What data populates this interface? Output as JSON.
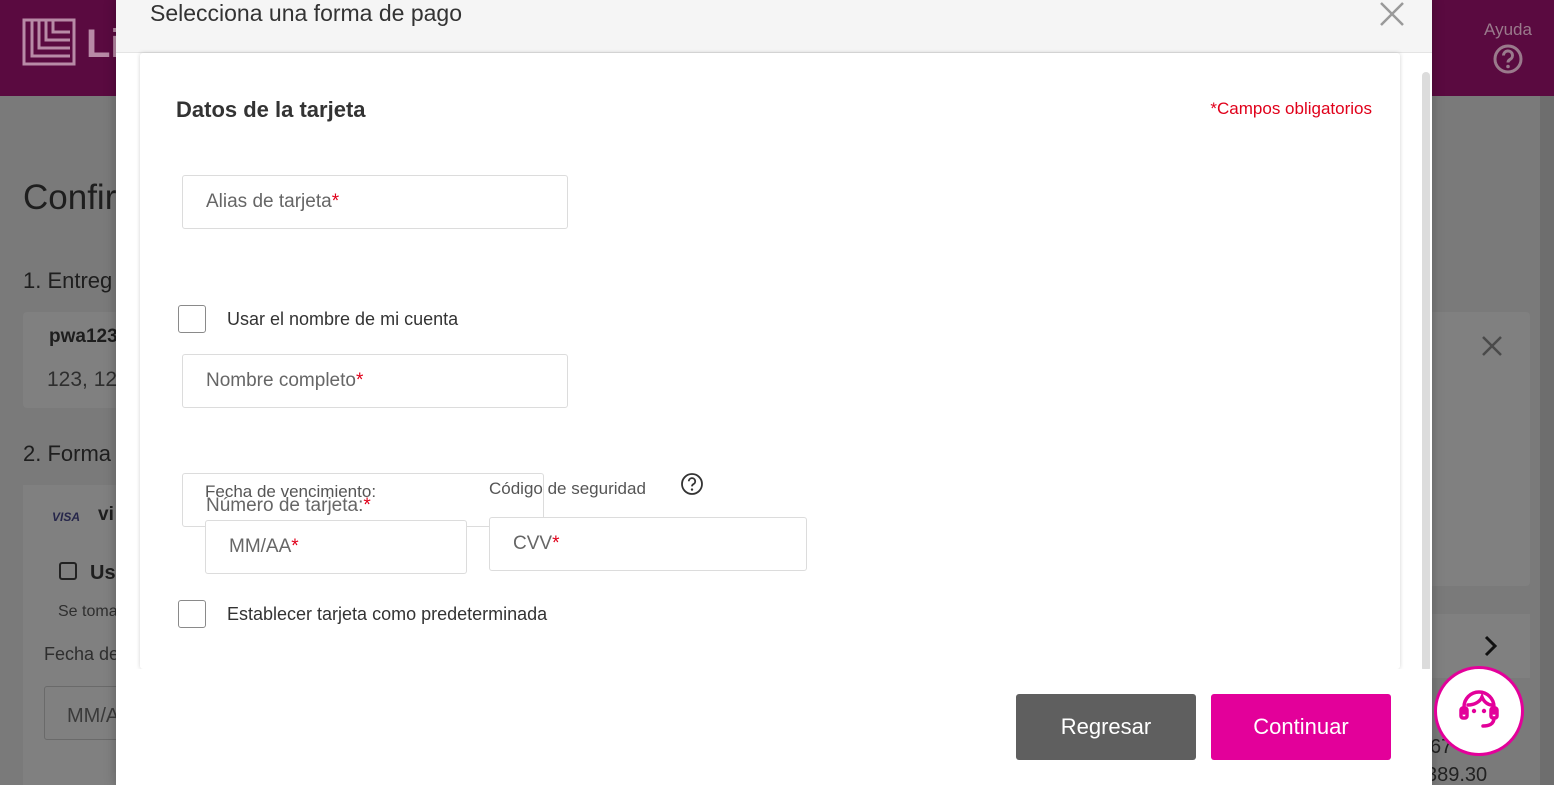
{
  "background": {
    "brand_text": "Li",
    "help_label": "Ayuda",
    "page_title": "Confir",
    "step1_label": "1. Entreg",
    "address_name": "pwa123",
    "address_line": "123, 12",
    "step2_label": "2. Forma",
    "visa_logo": "VISA",
    "visa_text": "vi",
    "checkbox_text": "Us",
    "info_text": "Se toma",
    "expiry_label": "Fecha de",
    "expiry_placeholder": "MM/A",
    "total_line1": "67",
    "total_line2": "389.30"
  },
  "modal": {
    "title": "Selecciona una forma de pago",
    "section_title": "Datos de la tarjeta",
    "required_note": "*Campos obligatorios",
    "fields": {
      "alias": "Alias de tarjeta",
      "full_name": "Nombre completo",
      "card_number": "Número de tarjeta:",
      "expiry_label": "Fecha de vencimiento:",
      "expiry_placeholder": "MM/AA",
      "security_label": "Código de seguridad",
      "cvv_placeholder": "CVV"
    },
    "required_star": "*",
    "use_account_name": "Usar el nombre de mi cuenta",
    "set_default": "Establecer tarjeta como predeterminada",
    "buttons": {
      "back": "Regresar",
      "continue": "Continuar"
    }
  },
  "colors": {
    "brand": "#e3009a",
    "required": "#e0001a",
    "back_button": "#5f5f5f"
  },
  "icons": {
    "close": "close-icon",
    "help": "help-circle-icon",
    "chat": "support-agent-icon"
  }
}
